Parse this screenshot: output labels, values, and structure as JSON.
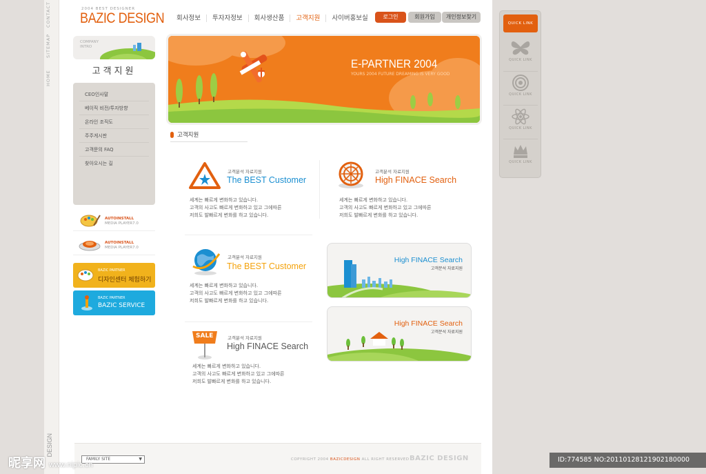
{
  "vertical_nav": [
    "CONTACT",
    "SITEMAP",
    "HOME"
  ],
  "vertical_design_label": "DESIGN",
  "logo": {
    "subtitle": "2004 BEST DESIGNER",
    "title": "BAZIC DESIGN"
  },
  "nav": {
    "items": [
      "회사정보",
      "투자자정보",
      "회사생산품",
      "고객지원",
      "사이버홍보실"
    ],
    "active_index": 3
  },
  "auth": {
    "login": "로그인",
    "join": "회원가입",
    "find": "개인정보찾기"
  },
  "intro": {
    "line1": "COMPANY",
    "line2": "INTRO"
  },
  "section_title": "고객지원",
  "side_menu": [
    "CEO인사말",
    "베이직 비전/투자방향",
    "온라인 조직도",
    "주주게시판",
    "고객문의 FAQ",
    "찾아오시는 길"
  ],
  "installs": [
    {
      "title": "AUTOINSTALL",
      "sub": "MEDIA PLAYER7.0"
    },
    {
      "title": "AUTOINSTALL",
      "sub": "MEDIA PLAYER7.0"
    }
  ],
  "promo_orange": {
    "small": "BAZIC PARTNER",
    "main": "디자인센터 체험하기"
  },
  "promo_blue": {
    "small": "BAZIC PARTNER",
    "main": "BAZIC SERVICE"
  },
  "hero": {
    "title": "E-PARTNER 2004",
    "subtitle": "YOURS 2004 FUTURE DREAMING IS VERY GOOD"
  },
  "breadcrumb": "고객지원",
  "blocks": [
    {
      "sub": "고객분석 자료지원",
      "title": "The BEST Customer",
      "color": "#1b8fd1",
      "lines": [
        "세계는 빠르게 변화하고 있습니다.",
        "고객의 사고도 빠르게 변화하고 있고 그에따른",
        "저희도 발빠르게 변화를 하고 있습니다."
      ]
    },
    {
      "sub": "고객분석 자료지원",
      "title": "High FINACE Search",
      "color": "#e2600f",
      "lines": [
        "세계는 빠르게 변화하고 있습니다.",
        "고객의 사고도 빠르게 변화하고 있고 그에따른",
        "저희도 발빠르게 변화를 하고 있습니다."
      ]
    },
    {
      "sub": "고객분석 자료지원",
      "title": "The BEST Customer",
      "color": "#f4a20b",
      "lines": [
        "세계는 빠르게 변화하고 있습니다.",
        "고객의 사고도 빠르게 변화하고 있고 그에따른",
        "저희도 발빠르게 변화를 하고 있습니다."
      ]
    },
    {
      "sub": "고객분석 자료지원",
      "title": "High FINACE Search",
      "color": "#555555",
      "lines": [
        "세계는 빠르게 변화하고 있습니다.",
        "고객의 사고도 빠르게 변화하고 있고 그에따른",
        "저희도 발빠르게 변화를 하고 있습니다."
      ]
    }
  ],
  "sale_label": "SALE",
  "cards": [
    {
      "title": "High FINACE Search",
      "sub": "고객분석 자료지원",
      "color": "#1b8fd1"
    },
    {
      "title": "High FINACE Search",
      "sub": "고객분석 자료지원",
      "color": "#e2600f"
    }
  ],
  "quick_links": {
    "top": "QUICK LINK",
    "items": [
      {
        "icon": "butterfly-icon",
        "label": "QUICK LINK"
      },
      {
        "icon": "target-icon",
        "label": "QUICK LINK"
      },
      {
        "icon": "atom-icon",
        "label": "QUICK LINK"
      },
      {
        "icon": "crown-icon",
        "label": "QUICK LINK"
      }
    ]
  },
  "footer": {
    "select": "FAMILY SITE",
    "copy_prefix": "COPYRIGHT 2004 ",
    "copy_brand": "BAZICDESIGN",
    "copy_suffix": " ALL RIGHT RESERVED",
    "logo": "BAZIC DESIGN"
  },
  "watermark": {
    "main": "昵享网",
    "sub": "www.nipic.cn"
  },
  "id_bar": "ID:774585 NO:20110128121902180000",
  "colors": {
    "accent": "#e2600f",
    "blue": "#1b8fd1"
  }
}
